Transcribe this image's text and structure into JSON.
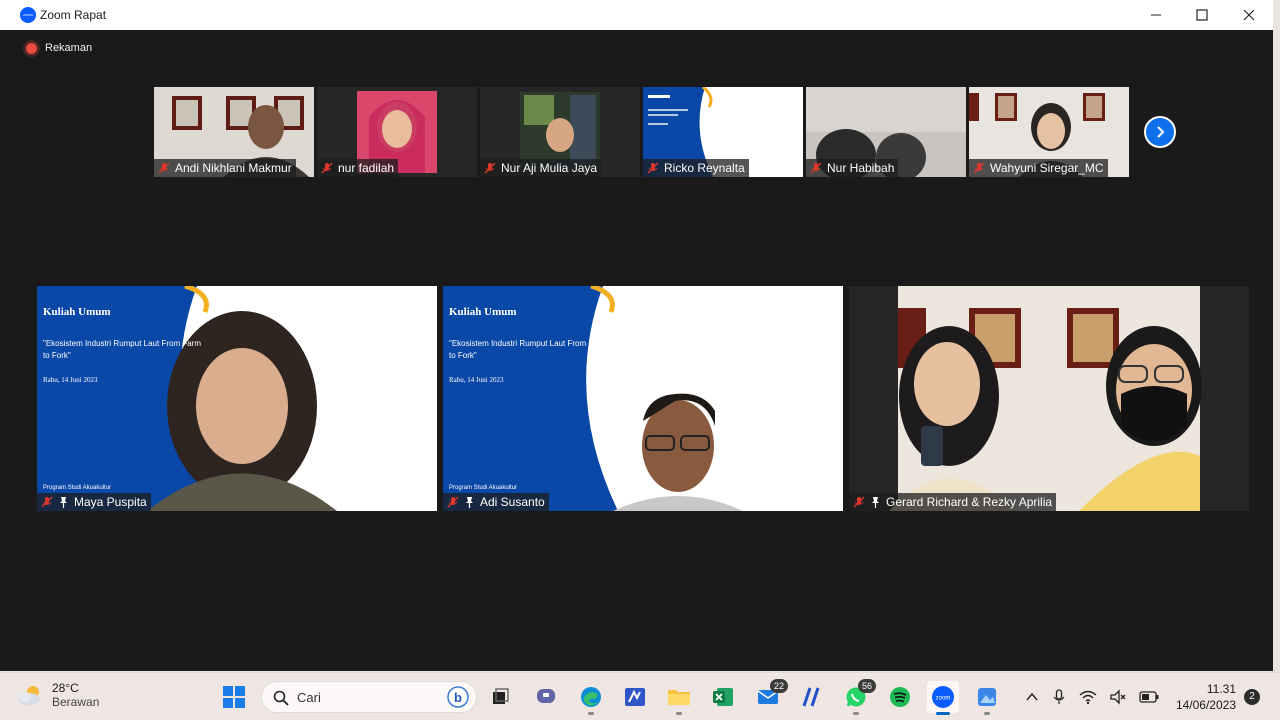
{
  "window": {
    "title": "Zoom Rapat",
    "app_icon_label": "zoom"
  },
  "recording": {
    "label": "Rekaman"
  },
  "gallery": {
    "strip": [
      {
        "name": "Andi Nikhlani Makmur"
      },
      {
        "name": "nur fadilah"
      },
      {
        "name": "Nur Aji Mulia Jaya"
      },
      {
        "name": "Ricko Reynalta"
      },
      {
        "name": "Nur Habibah"
      },
      {
        "name": "Wahyuni Siregar_MC"
      }
    ],
    "main": [
      {
        "name": "Maya Puspita"
      },
      {
        "name": "Adi Susanto"
      },
      {
        "name": "Gerard Richard & Rezky Aprilia"
      }
    ]
  },
  "slide": {
    "title": "Kuliah Umum",
    "subtitle": "\"Ekosistem Industri Rumput Laut From Farm to Fork\"",
    "date": "Rabu, 14 Juni 2023",
    "program": "Program Studi Akuakultur"
  },
  "taskbar": {
    "weather": {
      "temp": "28°C",
      "condition": "Berawan"
    },
    "search_placeholder": "Cari",
    "mail_badge": "22",
    "whatsapp_badge": "56",
    "clock": {
      "time": "11.31",
      "date": "14/06/2023"
    },
    "notifications": "2"
  },
  "colors": {
    "zoom_blue": "#0e71eb",
    "slide_blue": "#0a48a8",
    "slide_gold": "#f2b021",
    "window_bg": "#1a1a1a"
  }
}
